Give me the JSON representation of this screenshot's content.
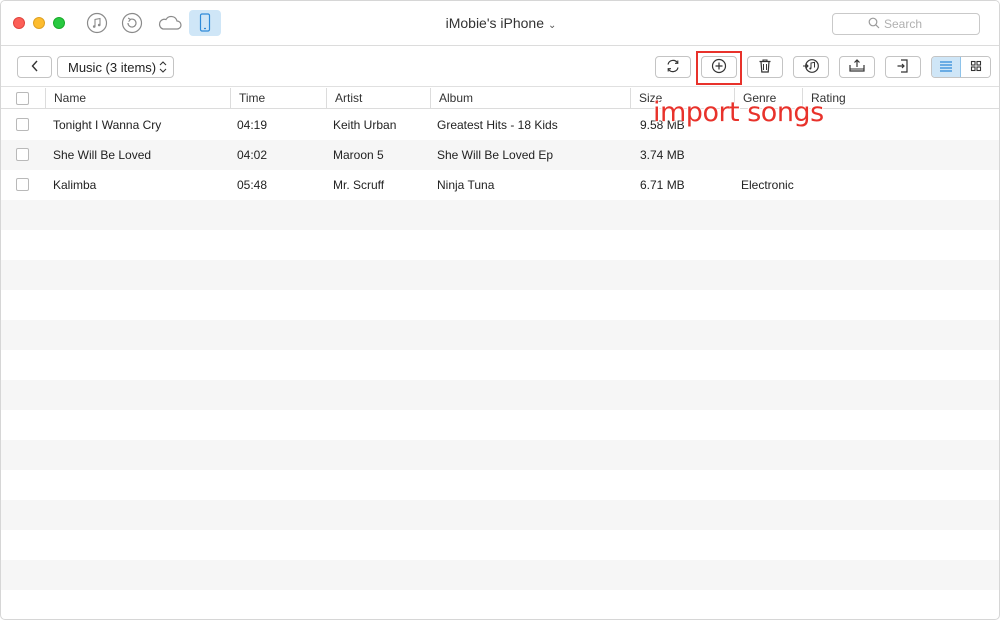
{
  "window": {
    "title": "iMobie's iPhone",
    "title_chevron": "⌄"
  },
  "titlebar": {
    "mode_icons": [
      "itunes-icon",
      "restore-icon",
      "icloud-icon",
      "iphone-icon"
    ],
    "active_mode": "iphone-icon"
  },
  "search": {
    "placeholder": "Search"
  },
  "toolbar": {
    "category_select": "Music (3 items)",
    "buttons": [
      "refresh-icon",
      "add-icon",
      "delete-icon",
      "send-to-itunes-icon",
      "send-to-computer-icon",
      "send-to-device-icon"
    ],
    "view_modes": [
      "list-view-icon",
      "grid-view-icon"
    ],
    "active_view": "list-view-icon"
  },
  "annotation": {
    "text": "import songs",
    "color": "#e8322b"
  },
  "table": {
    "columns": [
      "Name",
      "Time",
      "Artist",
      "Album",
      "Size",
      "Genre",
      "Rating"
    ],
    "rows": [
      {
        "name": "Tonight I Wanna Cry",
        "time": "04:19",
        "artist": "Keith Urban",
        "album": "Greatest Hits - 18 Kids",
        "size": "9.58 MB",
        "genre": "",
        "rating": ""
      },
      {
        "name": "She Will Be Loved",
        "time": "04:02",
        "artist": "Maroon 5",
        "album": "She Will Be Loved Ep",
        "size": "3.74 MB",
        "genre": "",
        "rating": ""
      },
      {
        "name": "Kalimba",
        "time": "05:48",
        "artist": "Mr. Scruff",
        "album": "Ninja Tuna",
        "size": "6.71 MB",
        "genre": "Electronic",
        "rating": ""
      }
    ]
  },
  "colors": {
    "accent": "#cfe6f7",
    "highlight": "#e8322b",
    "row_alt": "#f6f6f6"
  }
}
